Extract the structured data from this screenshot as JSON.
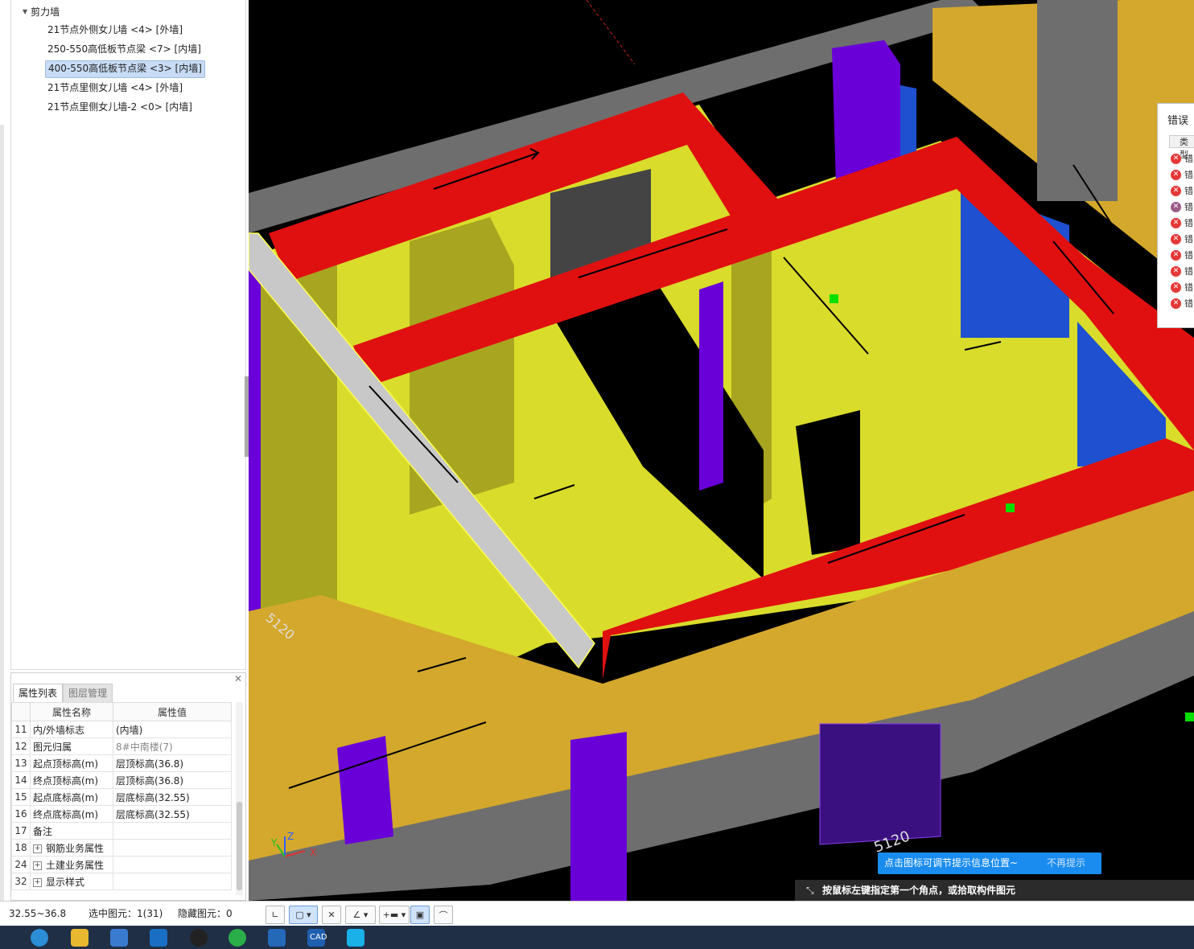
{
  "tree": {
    "root": "剪力墙",
    "items": [
      {
        "label": "21节点外侧女儿墙 <4> [外墙]",
        "selected": false
      },
      {
        "label": "250-550高低板节点梁 <7> [内墙]",
        "selected": false
      },
      {
        "label": "400-550高低板节点梁 <3> [内墙]",
        "selected": true
      },
      {
        "label": "21节点里侧女儿墙 <4> [外墙]",
        "selected": false
      },
      {
        "label": "21节点里侧女儿墙-2 <0> [内墙]",
        "selected": false
      }
    ]
  },
  "props": {
    "tabs": [
      "属性列表",
      "图层管理"
    ],
    "headers": [
      "属性名称",
      "属性值"
    ],
    "rows": [
      {
        "num": "11",
        "name": "内/外墙标志",
        "value": "(内墙)",
        "grey": false,
        "expand": false
      },
      {
        "num": "12",
        "name": "图元归属",
        "value": "8#中南楼(7)",
        "grey": true,
        "expand": false
      },
      {
        "num": "13",
        "name": "起点顶标高(m)",
        "value": "层顶标高(36.8)",
        "grey": false,
        "expand": false
      },
      {
        "num": "14",
        "name": "终点顶标高(m)",
        "value": "层顶标高(36.8)",
        "grey": false,
        "expand": false
      },
      {
        "num": "15",
        "name": "起点底标高(m)",
        "value": "层底标高(32.55)",
        "grey": false,
        "expand": false
      },
      {
        "num": "16",
        "name": "终点底标高(m)",
        "value": "层底标高(32.55)",
        "grey": false,
        "expand": false
      },
      {
        "num": "17",
        "name": "备注",
        "value": "",
        "grey": false,
        "expand": false
      },
      {
        "num": "18",
        "name": "钢筋业务属性",
        "value": "",
        "grey": false,
        "expand": true
      },
      {
        "num": "24",
        "name": "土建业务属性",
        "value": "",
        "grey": false,
        "expand": true
      },
      {
        "num": "32",
        "name": "显示样式",
        "value": "",
        "grey": false,
        "expand": true
      }
    ]
  },
  "error_panel": {
    "title": "错误",
    "column": "类型",
    "row_label": "错",
    "rows": 10
  },
  "viewport": {
    "axis": {
      "x": "X",
      "y": "Y",
      "z": "Z"
    },
    "dims": [
      "5120",
      "5120"
    ],
    "colors": {
      "wall": "#d9dc2a",
      "beam": "#e01010",
      "column": "#6a00d8",
      "slab": "#6e6e6e",
      "ext": "#d4a82c",
      "sel": "#c8c8c8"
    }
  },
  "tip": {
    "text": "点击图标可调节提示信息位置~",
    "dismiss": "不再提示"
  },
  "prompt": "按鼠标左键指定第一个角点，或拾取构件图元",
  "status": {
    "elevation": "32.55~36.8",
    "selected": "选中图元：1(31)",
    "hidden": "隐藏图元：0"
  },
  "taskbar": {
    "app_label": "CAD"
  }
}
